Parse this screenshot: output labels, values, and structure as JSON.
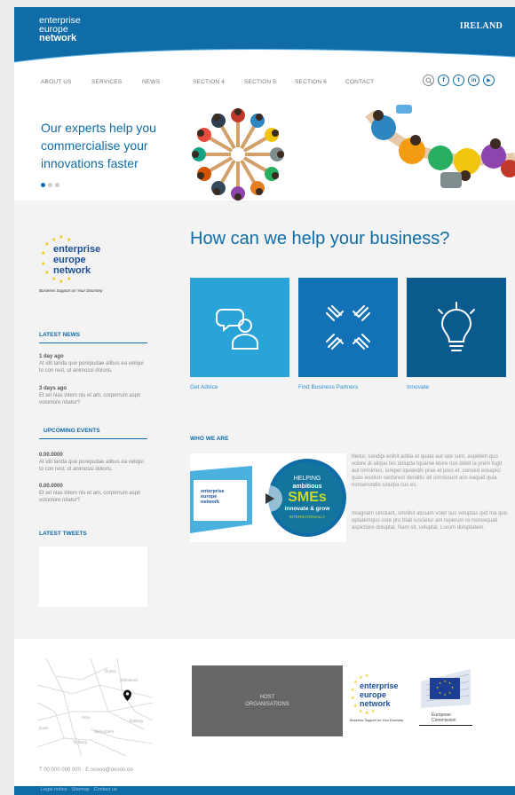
{
  "header": {
    "logo_line1": "enterprise",
    "logo_line2": "europe",
    "logo_line3": "network",
    "country": "IRELAND"
  },
  "nav": {
    "items": [
      "ABOUT US",
      "SERVICES",
      "NEWS",
      "SECTION 4",
      "SECTION 5",
      "SECTION 6",
      "CONTACT"
    ],
    "icons": [
      "search-icon",
      "facebook-icon",
      "twitter-icon",
      "linkedin-icon",
      "youtube-icon"
    ],
    "social_glyphs": [
      "f",
      "t",
      "in",
      "▶"
    ]
  },
  "hero": {
    "title": "Our experts help you commercialise your innovations faster",
    "slides": 3,
    "active_slide": 1
  },
  "sidebar": {
    "logo": {
      "line1": "enterprise",
      "line2": "europe",
      "line3": "network",
      "tagline": "Business Support on Your Doorstep"
    },
    "latest_news_title": "LATEST NEWS",
    "news": [
      {
        "date": "1 day ago",
        "text": "At idit landa que porepudae alibus ea veliqui to con rest, ut animossi doloris."
      },
      {
        "date": "3 days ago",
        "text": "Et ari nias intem nis et am, corporrum aspit volonlore nitatur?"
      }
    ],
    "upcoming_events_title": "UPCOMING EVENTS",
    "events": [
      {
        "date": "0.00.0000",
        "text": "At idit landa que porepudae alibus ea veliqui to con rest, ut animossi doloris."
      },
      {
        "date": "0.00.0000",
        "text": "Et ari nias intem nis et am, corporrum aspit volonlore nitatur?"
      }
    ],
    "latest_tweets_title": "LATEST TWEETS"
  },
  "main": {
    "title": "How can we help your business?",
    "tiles": [
      {
        "label": "Get Advice",
        "icon": "advice-icon",
        "color": "#2aa3d8"
      },
      {
        "label": "Find Business Partners",
        "icon": "partners-icon",
        "color": "#1172b5"
      },
      {
        "label": "Innovate",
        "icon": "lightbulb-icon",
        "color": "#0b5a8e"
      }
    ],
    "who_we_are_title": "WHO WE ARE",
    "video": {
      "line1": "HELPING",
      "line2": "ambitious",
      "line3": "SMEs",
      "line4": "innovate & grow",
      "line5": "INTERNATIONALLY"
    },
    "paragraph1": "Metur, sandipi enihit aditia et quate aut late sunt, aspidem quo volore di aliquo tes dolupta tquame eture nos debit la prem fugit aut omnimus, iurepel iquiandis prae et pres et, consed eosapici quas eostion sectorest denditis ati omnissunt aris eaquid quia nonserundis sinulpa cus es.",
    "paragraph2": "Imagnam sinctiant, omnihit atusam volor sus voluptas ipid ma quo optatemquo core pro blab iuscietur am reperum re nonsequati aspictiore doluptat. Nam sit, voluptat. Lorum doluptatem."
  },
  "footer": {
    "map_places": [
      "Mullen",
      "Bollebeek",
      "Asse",
      "Kobbeg",
      "Jesek",
      "Wolleghem",
      "Terlberg"
    ],
    "contact": "T 00 000 000 000 · E ooooo@ooooo.oo",
    "host_line1": "HOST",
    "host_line2": "ORGANISATIONS",
    "logo": {
      "line1": "enterprise",
      "line2": "europe",
      "line3": "network",
      "tagline": "Business Support on Your Doorstep"
    },
    "ec_line1": "European",
    "ec_line2": "Commission",
    "legal": "Legal notice · Sitemap · Contact us"
  },
  "colors": {
    "brand_blue": "#0f6ca7",
    "tile_light": "#2aa3d8",
    "tile_mid": "#1172b5",
    "tile_dark": "#0b5a8e",
    "star_yellow": "#f5c400"
  }
}
